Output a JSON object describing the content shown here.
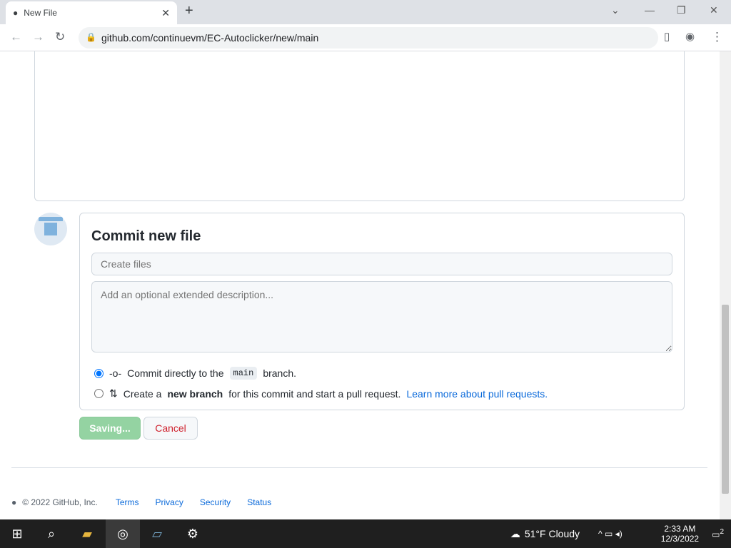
{
  "browser": {
    "tab_title": "New File",
    "url": "github.com/continuevm/EC-Autoclicker/new/main"
  },
  "commit": {
    "heading": "Commit new file",
    "summary_placeholder": "Create files",
    "description_placeholder": "Add an optional extended description...",
    "option_direct": {
      "prefix": "Commit directly to the",
      "branch": "main",
      "suffix": "branch."
    },
    "option_new": {
      "prefix": "Create a",
      "bold": "new branch",
      "suffix": "for this commit and start a pull request.",
      "link": "Learn more about pull requests."
    }
  },
  "buttons": {
    "save": "Saving...",
    "cancel": "Cancel"
  },
  "footer": {
    "copyright": "© 2022 GitHub, Inc.",
    "links": [
      "Terms",
      "Privacy",
      "Security",
      "Status"
    ]
  },
  "taskbar": {
    "weather": "51°F  Cloudy",
    "time": "2:33 AM",
    "date": "12/3/2022",
    "notif": "2"
  }
}
